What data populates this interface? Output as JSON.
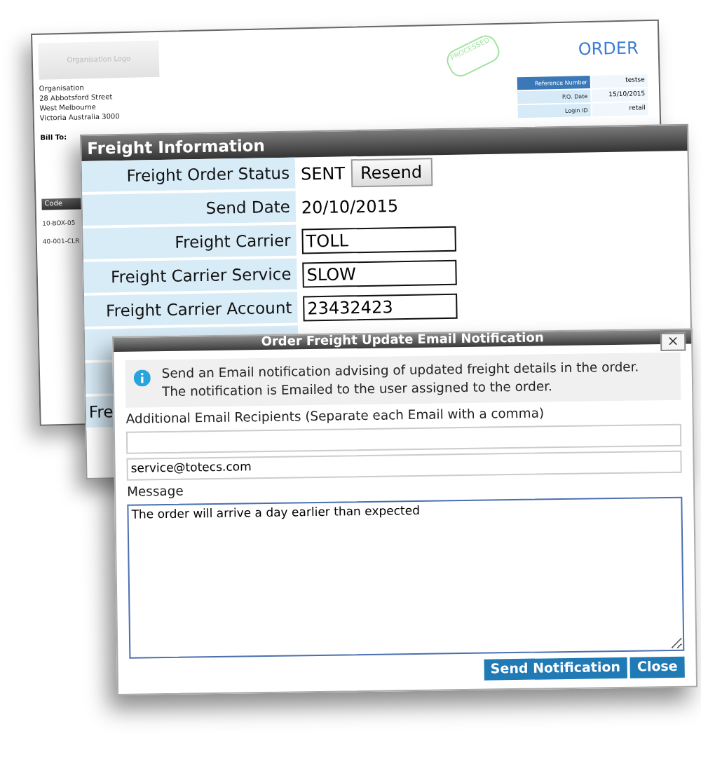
{
  "order_sheet": {
    "logo": "Organisation Logo",
    "stamp": "PROCESSED",
    "title": "ORDER",
    "address": [
      "Organisation",
      "28 Abbotsford Street",
      "West Melbourne",
      "Victoria Australia 3000"
    ],
    "bill_to": "Bill To:",
    "details": [
      {
        "label": "Reference Number",
        "value": "testse",
        "selected": true
      },
      {
        "label": "P.O. Date",
        "value": "15/10/2015",
        "selected": false
      },
      {
        "label": "Login ID",
        "value": "retail",
        "selected": false
      }
    ],
    "code_column": {
      "heading": "Code",
      "rows": [
        "10-BOX-05",
        "40-001-CLR"
      ]
    }
  },
  "freight_window": {
    "title": "Freight Information",
    "rows": [
      {
        "label": "Freight Order Status",
        "kind": "status",
        "value": "SENT",
        "button": "Resend"
      },
      {
        "label": "Send Date",
        "kind": "text",
        "value": "20/10/2015"
      },
      {
        "label": "Freight Carrier",
        "kind": "input",
        "value": "TOLL"
      },
      {
        "label": "Freight Carrier Service",
        "kind": "input",
        "value": "SLOW"
      },
      {
        "label": "Freight Carrier Account",
        "kind": "input",
        "value": "23432423"
      },
      {
        "label": "",
        "kind": "blank"
      },
      {
        "label": "",
        "kind": "blank"
      },
      {
        "label": "Fre",
        "kind": "blank"
      }
    ]
  },
  "dialog": {
    "title": "Order Freight Update Email Notification",
    "close": "×",
    "info": [
      "Send an Email notification advising of updated freight details in the order.",
      "The notification is Emailed to the user assigned to the order."
    ],
    "recipients_label": "Additional Email Recipients (Separate each Email with a comma)",
    "recipients_value": "service@totecs.com",
    "message_label": "Message",
    "message_value": "The order will arrive a day earlier than expected",
    "buttons": [
      "Send Notification",
      "Close"
    ]
  }
}
